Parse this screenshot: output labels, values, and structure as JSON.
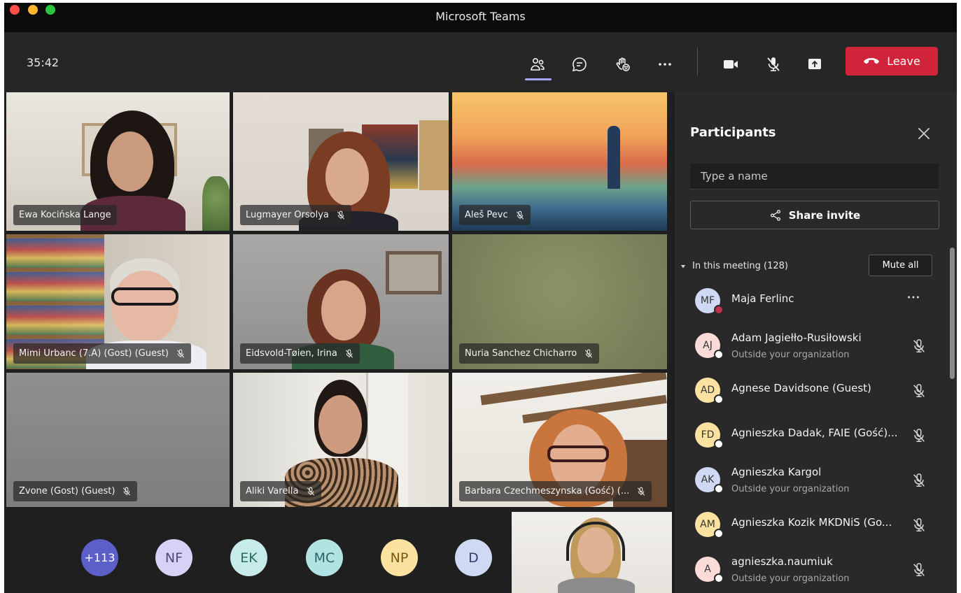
{
  "window": {
    "title": "Microsoft Teams"
  },
  "controls": {
    "timer": "35:42",
    "leave_label": "Leave",
    "icons": [
      "people-icon",
      "chat-icon",
      "raise-hand-icon",
      "more-options-icon",
      "camera-icon",
      "mic-muted-icon",
      "share-screen-icon",
      "phone-hangup-icon"
    ]
  },
  "colors": {
    "leave": "#d0243a",
    "accent": "#a7a4f3",
    "background": "#1f1f1f",
    "panel": "#292929"
  },
  "video_tiles": [
    {
      "name": "Ewa Kocińska Lange",
      "muted": false
    },
    {
      "name": "Lugmayer Orsolya",
      "muted": true
    },
    {
      "name": "Aleš Pevc",
      "muted": true
    },
    {
      "name": "Mimi Urbanc (7.A) (Gost) (Guest)",
      "muted": true
    },
    {
      "name": "Eidsvold-Tøien, Irina",
      "muted": true
    },
    {
      "name": "Nuria Sanchez Chicharro",
      "muted": true
    },
    {
      "name": "Zvone (Gost) (Guest)",
      "muted": true
    },
    {
      "name": "Aliki Varella",
      "muted": true
    },
    {
      "name": "Barbara Czechmeszynska (Gość) (...",
      "muted": true
    }
  ],
  "bottom_avatars": [
    {
      "initials": "+113",
      "color": "#5b5fc7"
    },
    {
      "initials": "NF",
      "color": "#d6d1f5"
    },
    {
      "initials": "EK",
      "color": "#c6ebe9"
    },
    {
      "initials": "MC",
      "color": "#b2e3e3"
    },
    {
      "initials": "NP",
      "color": "#fbe2a0"
    },
    {
      "initials": "D",
      "color": "#cfd9f3"
    }
  ],
  "participants_panel": {
    "title": "Participants",
    "search_placeholder": "Type a name",
    "share_invite_label": "Share invite",
    "in_meeting_label": "In this meeting (128)",
    "mute_all_label": "Mute all",
    "participants": [
      {
        "initials": "MF",
        "name": "Maja Ferlinc",
        "subtitle": "",
        "avatar_color": "#cfd9f3",
        "status": "busy",
        "action": "more"
      },
      {
        "initials": "AJ",
        "name": "Adam Jagiełło-Rusiłowski",
        "subtitle": "Outside your organization",
        "avatar_color": "#fadbd8",
        "status": "external",
        "action": "mic-muted"
      },
      {
        "initials": "AD",
        "name": "Agnese Davidsone (Guest)",
        "subtitle": "",
        "avatar_color": "#fbe2a0",
        "status": "external",
        "action": "mic-muted"
      },
      {
        "initials": "FD",
        "name": "Agnieszka Dadak, FAIE (Gość)...",
        "subtitle": "",
        "avatar_color": "#fbe2a0",
        "status": "external",
        "action": "mic-muted"
      },
      {
        "initials": "AK",
        "name": "Agnieszka Kargol",
        "subtitle": "Outside your organization",
        "avatar_color": "#cfd9f3",
        "status": "external",
        "action": "mic-muted"
      },
      {
        "initials": "AM",
        "name": "Agnieszka Kozik MKDNiS (Go...",
        "subtitle": "",
        "avatar_color": "#fbe2a0",
        "status": "external",
        "action": "mic-muted"
      },
      {
        "initials": "A",
        "name": "agnieszka.naumiuk",
        "subtitle": "Outside your organization",
        "avatar_color": "#fadbd8",
        "status": "external",
        "action": "mic-muted"
      }
    ]
  }
}
